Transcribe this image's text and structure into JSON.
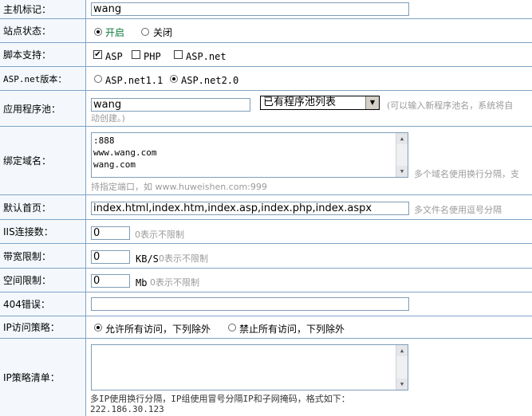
{
  "host": {
    "label": "主机标记：",
    "value": "wang"
  },
  "status": {
    "label": "站点状态：",
    "options": [
      "开启",
      "关闭"
    ],
    "selected": "开启"
  },
  "script": {
    "label": "脚本支持：",
    "options": [
      {
        "label": "ASP",
        "checked": true
      },
      {
        "label": "PHP",
        "checked": false
      },
      {
        "label": "ASP.net",
        "checked": false
      }
    ]
  },
  "aspnet": {
    "label": "ASP.net版本：",
    "options": [
      "ASP.net1.1",
      "ASP.net2.0"
    ],
    "selected": "ASP.net2.0"
  },
  "pool": {
    "label": "应用程序池：",
    "value": "wang",
    "select_value": "已有程序池列表",
    "hint_line1": "(可以输入新程序池名，系统将自",
    "hint_line2": "动创建。)"
  },
  "domain": {
    "label": "绑定域名：",
    "lines": [
      ":888",
      "www.wang.com",
      "wang.com"
    ],
    "hint_right": "多个域名使用换行分隔，支",
    "hint_below": "持指定端口，如 www.huweishen.com:999"
  },
  "index": {
    "label": "默认首页：",
    "value": "index.html,index.htm,index.asp,index.php,index.aspx",
    "hint": "多文件名使用逗号分隔"
  },
  "iis": {
    "label": "IIS连接数：",
    "value": "0",
    "hint": "0表示不限制"
  },
  "bandwidth": {
    "label": "带宽限制：",
    "value": "0",
    "unit": "KB/S",
    "hint": "0表示不限制"
  },
  "space": {
    "label": "空间限制：",
    "value": "0",
    "unit": "Mb",
    "hint": "0表示不限制"
  },
  "error404": {
    "label": "404错误：",
    "value": ""
  },
  "ip_policy": {
    "label": "IP访问策略：",
    "options": [
      "允许所有访问，下列除外",
      "禁止所有访问，下列除外"
    ],
    "selected": "允许所有访问，下列除外"
  },
  "ip_list": {
    "label": "IP策略清单：",
    "hint_line1": "多IP使用换行分隔，IP组使用冒号分隔IP和子网掩码，格式如下：",
    "hint_line2": "222.186.30.123"
  }
}
